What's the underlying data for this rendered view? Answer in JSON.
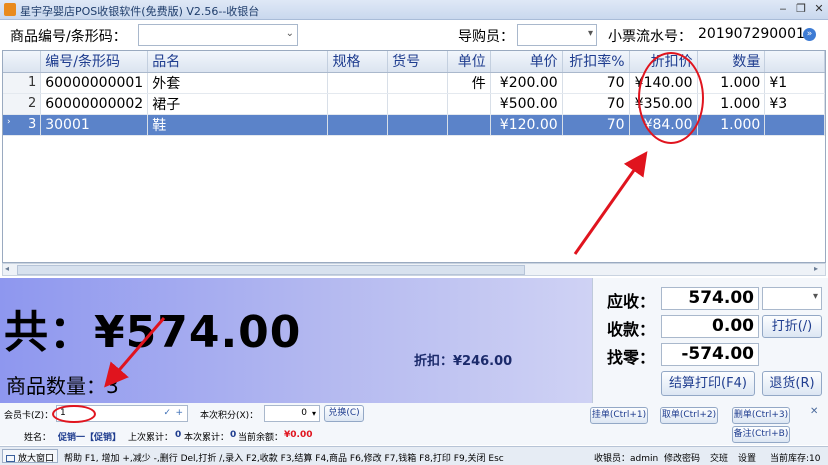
{
  "window": {
    "title": "星宇孕婴店POS收银软件(免费版) V2.56--收银台"
  },
  "toolbar": {
    "product_code_label": "商品编号/条形码：",
    "guide_label": "导购员：",
    "receipt_label": "小票流水号：",
    "receipt_no": "201907290001"
  },
  "grid": {
    "columns": [
      "编号/条形码",
      "品名",
      "规格",
      "货号",
      "单位",
      "单价",
      "折扣率%",
      "折扣价",
      "数量",
      ""
    ],
    "rows": [
      {
        "no": "1",
        "code": "60000000001",
        "name": "外套",
        "spec": "",
        "sku": "",
        "unit": "件",
        "price": "¥200.00",
        "rate": "70",
        "dprice": "¥140.00",
        "qty": "1.000",
        "amt": "¥1"
      },
      {
        "no": "2",
        "code": "60000000002",
        "name": "裙子",
        "spec": "",
        "sku": "",
        "unit": "",
        "price": "¥500.00",
        "rate": "70",
        "dprice": "¥350.00",
        "qty": "1.000",
        "amt": "¥3"
      },
      {
        "no": "3",
        "code": "30001",
        "name": "鞋",
        "spec": "",
        "sku": "",
        "unit": "",
        "price": "¥120.00",
        "rate": "70",
        "dprice": "¥84.00",
        "qty": "1.000",
        "amt": ""
      }
    ]
  },
  "summary": {
    "total": "共：¥574.00",
    "qty": "商品数量：3",
    "discount": "折扣：¥246.00"
  },
  "pay": {
    "receivable_label": "应收：",
    "receivable": "574.00",
    "received_label": "收款：",
    "received": "0.00",
    "change_label": "找零：",
    "change": "-574.00",
    "discount_btn": "打折(/)",
    "checkout_btn": "结算打印(F4)",
    "return_btn": "退货(R)"
  },
  "member": {
    "card_label": "会员卡(Z)：",
    "card_value": "1",
    "points_label": "本次积分(X)：",
    "points_value": "0",
    "redeem_btn": "兑换(C)",
    "hang_btn": "挂单(Ctrl+1)",
    "take_btn": "取单(Ctrl+2)",
    "delete_btn": "删单(Ctrl+3)",
    "note_btn": "备注(Ctrl+B)",
    "name_label": "姓名：",
    "name_value": "促销一【促销】",
    "last_total_label": "上次累计：",
    "last_total": "0",
    "this_total_label": "本次累计：",
    "this_total": "0",
    "balance_label": "当前余额：",
    "balance": "¥0.00"
  },
  "status": {
    "enlarge_btn": "放大窗口",
    "help": "帮助 F1, 增加 +,减少 -,删行 Del,打折 /,录入 F2,收款 F3,结算 F4,商品 F6,修改 F7,钱箱 F8,打印 F9,关闭 Esc",
    "cashier": "收银员：admin",
    "change_pwd": "修改密码",
    "shift": "交班",
    "settings": "设置",
    "stock": "当前库存:10"
  },
  "colors": {
    "accent": "#1f3d8f",
    "selected_row": "#5b83c9",
    "annotation": "#e0141e",
    "negative": "#e0141e"
  }
}
